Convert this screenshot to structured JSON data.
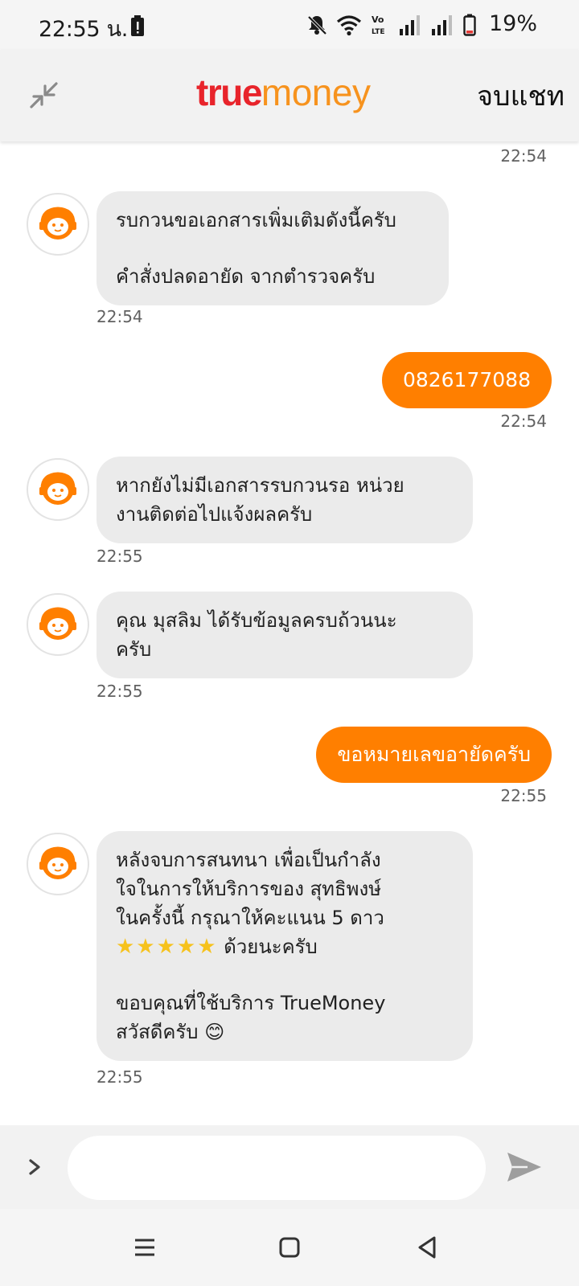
{
  "status_bar": {
    "time": "22:55 น.",
    "battery_percent": "19%"
  },
  "header": {
    "logo_part1": "true",
    "logo_part2": "money",
    "end_chat_label": "จบแชท"
  },
  "colors": {
    "brand_orange": "#ff7f00",
    "brand_red": "#e8242b",
    "bubble_incoming": "#ebebeb"
  },
  "messages": [
    {
      "timestamp": "22:54"
    },
    {
      "from": "agent",
      "lines": [
        "รบกวนขอเอกสารเพิ่มเติมดังนี้ครับ",
        "คำสั่งปลดอายัด จากตำรวจครับ"
      ],
      "timestamp": "22:54"
    },
    {
      "from": "user",
      "text": "0826177088",
      "timestamp": "22:54"
    },
    {
      "from": "agent",
      "lines": [
        "หากยังไม่มีเอกสารรบกวนรอ หน่วย",
        "งานติดต่อไปแจ้งผลครับ"
      ],
      "timestamp": "22:55"
    },
    {
      "from": "agent",
      "lines": [
        "คุณ มุสลิม ได้รับข้อมูลครบถ้วนนะ",
        "ครับ"
      ],
      "timestamp": "22:55"
    },
    {
      "from": "user",
      "text": "ขอหมายเลขอายัดครับ",
      "timestamp": "22:55"
    },
    {
      "from": "agent",
      "lines": [
        "หลังจบการสนทนา เพื่อเป็นกำลัง",
        "ใจในการให้บริการของ สุทธิพงษ์",
        "ในครั้งนี้ กรุณาให้คะแนน 5 ดาว",
        "ด้วยนะครับ",
        "ขอบคุณที่ใช้บริการ TrueMoney",
        "สวัสดีครับ"
      ],
      "stars": "★★★★★",
      "emoji": "😊",
      "timestamp": "22:55"
    }
  ],
  "input": {
    "placeholder": ""
  },
  "icons": {
    "agent_avatar": "agent-headset-icon",
    "send": "send-icon",
    "expand": "chevron-right-icon",
    "minimize": "minimize-icon"
  }
}
